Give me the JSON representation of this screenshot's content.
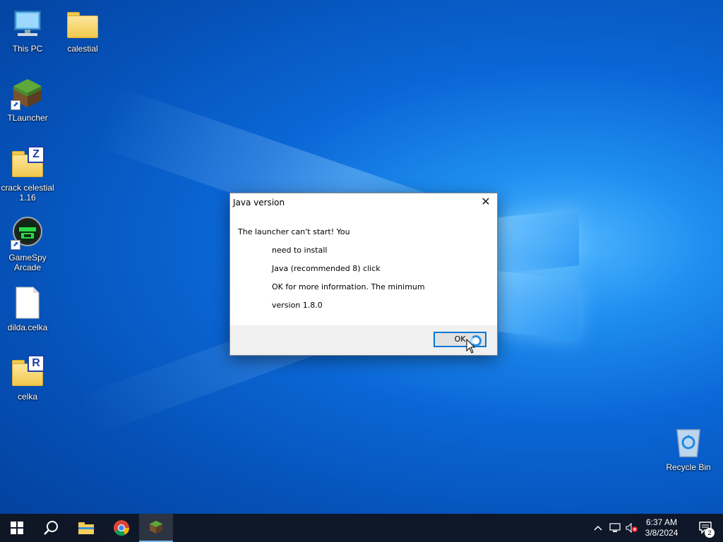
{
  "desktop": {
    "icons": [
      {
        "label": "This PC",
        "icon": "computer-icon"
      },
      {
        "label": "calestial",
        "icon": "folder-icon"
      },
      {
        "label": "TLauncher",
        "icon": "minecraft-grass-block-icon"
      },
      {
        "label": "crack celestial 1.16",
        "icon": "zip-folder-icon"
      },
      {
        "label": "GameSpy Arcade",
        "icon": "gamespy-icon"
      },
      {
        "label": "dilda.celka",
        "icon": "file-icon"
      },
      {
        "label": "celka",
        "icon": "rar-folder-icon"
      },
      {
        "label": "Recycle Bin",
        "icon": "recycle-bin-icon"
      }
    ],
    "badges": {
      "zip": "Z",
      "rar": "R"
    },
    "shortcut_glyph": "⬈"
  },
  "dialog": {
    "title": "Java version",
    "close_glyph": "✕",
    "lines": [
      "The launcher can't start! You",
      "need to install",
      "Java (recommended 8) click",
      "OK for more information. The minimum",
      "version 1.8.0"
    ],
    "ok_label": "OK"
  },
  "taskbar": {
    "buttons": [
      "start-icon",
      "search-icon",
      "file-explorer-icon",
      "chrome-icon",
      "tlauncher-icon"
    ],
    "tray": {
      "chevron": "^",
      "time": "6:37 AM",
      "date": "3/8/2024",
      "notification_count": "2"
    }
  },
  "colors": {
    "accent": "#0078d7",
    "taskbar": "#101622",
    "desktop": "#0b67d6"
  }
}
